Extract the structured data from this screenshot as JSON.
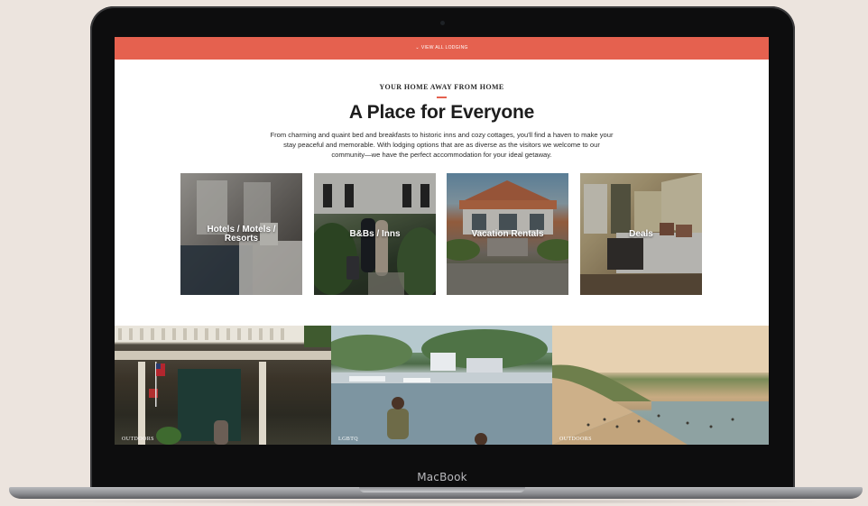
{
  "device": {
    "brand": "MacBook"
  },
  "site": {
    "top_bar": {
      "label": "VIEW ALL LODGING",
      "chevron_icon": "chevron-down-icon",
      "color": "#e5614f"
    },
    "section": {
      "eyebrow": "YOUR HOME AWAY FROM HOME",
      "title": "A Place for Everyone",
      "intro": "From charming and quaint bed and breakfasts to historic inns and cozy cottages, you'll find a haven to make your stay peaceful and memorable. With lodging options that are as diverse as the visitors we welcome to our community—we have the perfect accommodation for your ideal getaway."
    },
    "cards": [
      {
        "label": "Hotels / Motels / Resorts"
      },
      {
        "label": "B&Bs / Inns"
      },
      {
        "label": "Vacation Rentals"
      },
      {
        "label": "Deals"
      }
    ],
    "photo_tiles": [
      {
        "tag": "OUTDOORS"
      },
      {
        "tag": "LGBTQ"
      },
      {
        "tag": "OUTDOORS"
      }
    ]
  }
}
